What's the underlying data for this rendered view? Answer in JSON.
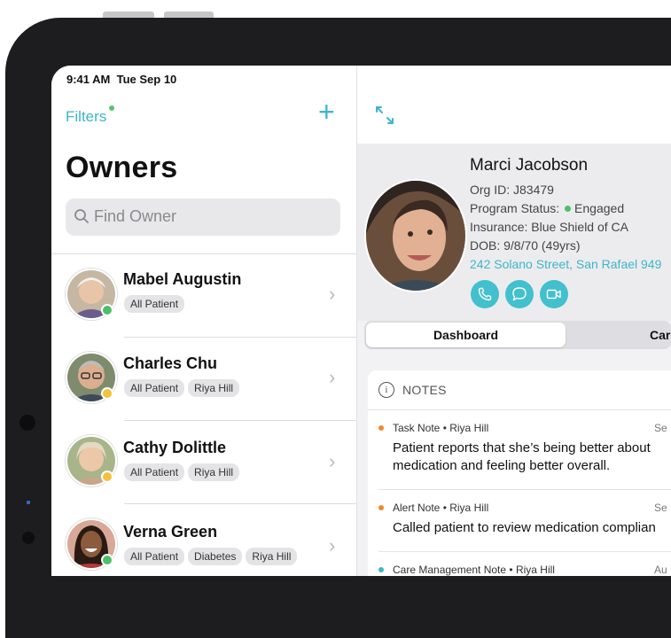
{
  "status_bar": {
    "time": "9:41 AM",
    "date": "Tue Sep 10"
  },
  "sidebar": {
    "filters_label": "Filters",
    "add_label": "+",
    "title": "Owners",
    "search_placeholder": "Find Owner",
    "owners": [
      {
        "name": "Mabel Augustin",
        "tags": [
          "All Patient"
        ],
        "status_color": "#4cbf6a"
      },
      {
        "name": "Charles Chu",
        "tags": [
          "All Patient",
          "Riya Hill"
        ],
        "status_color": "#f5c13a"
      },
      {
        "name": "Cathy Dolittle",
        "tags": [
          "All Patient",
          "Riya Hill"
        ],
        "status_color": "#f5c13a"
      },
      {
        "name": "Verna Green",
        "tags": [
          "All Patient",
          "Diabetes",
          "Riya Hill"
        ],
        "status_color": "#4cbf6a"
      }
    ]
  },
  "patient": {
    "name": "Marci Jacobson",
    "org_id": "Org ID: J83479",
    "program_status_label": "Program Status:",
    "program_status_value": "Engaged",
    "insurance": "Insurance: Blue Shield of CA",
    "dob": "DOB: 9/8/70 (49yrs)",
    "address": "242 Solano Street, San Rafael 949",
    "actions": [
      "phone-icon",
      "message-icon",
      "video-icon"
    ]
  },
  "tabs": {
    "active": "Dashboard",
    "next": "Care"
  },
  "notes": {
    "header": "NOTES",
    "items": [
      {
        "meta": "Task Note • Riya Hill",
        "date": "Se",
        "text": [
          "Patient reports that she’s being better about",
          "medication and feeling better overall."
        ],
        "dot_color": "#f08a2c"
      },
      {
        "meta": "Alert Note • Riya Hill",
        "date": "Se",
        "text": [
          "Called patient to review medication complian"
        ],
        "dot_color": "#f08a2c"
      },
      {
        "meta": "Care Management Note • Riya Hill",
        "date": "Au",
        "text": [],
        "dot_color": "#3cb6c9"
      }
    ]
  },
  "colors": {
    "accent": "#3cb6c9",
    "engaged": "#4cbf6a"
  }
}
